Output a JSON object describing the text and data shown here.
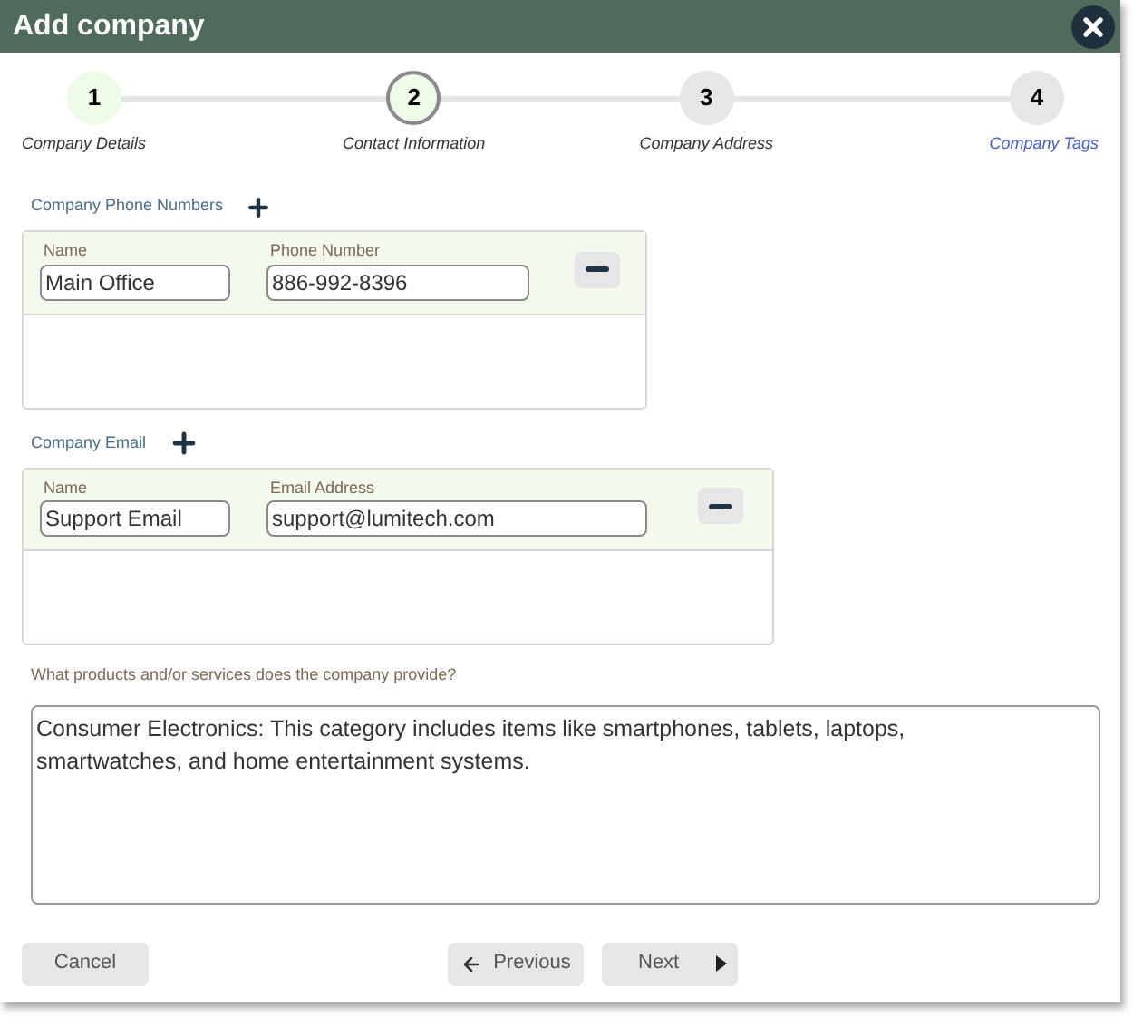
{
  "dialog": {
    "title": "Add company"
  },
  "steps": [
    {
      "number": "1",
      "label": "Company Details",
      "completed": true,
      "selected": false,
      "link": false
    },
    {
      "number": "2",
      "label": "Contact Information",
      "completed": false,
      "selected": true,
      "link": false
    },
    {
      "number": "3",
      "label": "Company Address",
      "completed": false,
      "selected": false,
      "link": false
    },
    {
      "number": "4",
      "label": "Company Tags",
      "completed": false,
      "selected": false,
      "link": true
    }
  ],
  "phone_section": {
    "label": "Company Phone Numbers",
    "rows": [
      {
        "name_label": "Name",
        "name_value": "Main Office",
        "value_label": "Phone Number",
        "value": "886-992-8396"
      }
    ]
  },
  "email_section": {
    "label": "Company Email",
    "rows": [
      {
        "name_label": "Name",
        "name_value": "Support Email",
        "value_label": "Email Address",
        "value": "support@lumitech.com"
      }
    ]
  },
  "products": {
    "label": "What products and/or services does the company provide?",
    "value": "Consumer Electronics: This category includes items like smartphones, tablets, laptops, smartwatches, and home entertainment systems."
  },
  "buttons": {
    "cancel": "Cancel",
    "previous": "Previous",
    "next": "Next"
  }
}
